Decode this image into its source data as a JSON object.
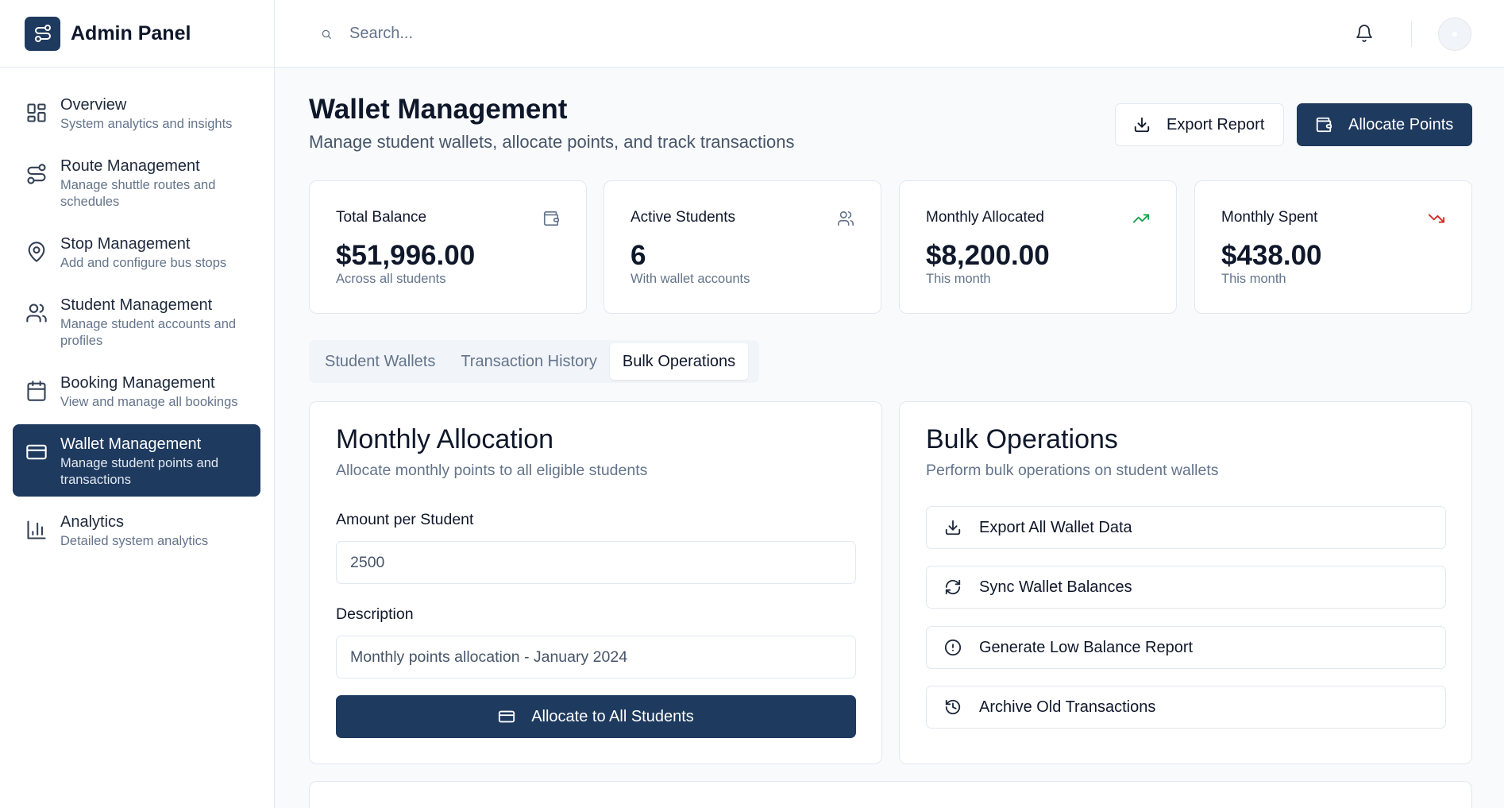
{
  "app": {
    "title": "Admin Panel"
  },
  "search": {
    "placeholder": "Search..."
  },
  "sidebar": {
    "items": [
      {
        "label": "Overview",
        "desc": "System analytics and insights",
        "icon": "grid-icon"
      },
      {
        "label": "Route Management",
        "desc": "Manage shuttle routes and schedules",
        "icon": "route-icon"
      },
      {
        "label": "Stop Management",
        "desc": "Add and configure bus stops",
        "icon": "map-pin-icon"
      },
      {
        "label": "Student Management",
        "desc": "Manage student accounts and profiles",
        "icon": "users-icon"
      },
      {
        "label": "Booking Management",
        "desc": "View and manage all bookings",
        "icon": "calendar-icon"
      },
      {
        "label": "Wallet Management",
        "desc": "Manage student points and transactions",
        "icon": "credit-card-icon",
        "active": true
      },
      {
        "label": "Analytics",
        "desc": "Detailed system analytics",
        "icon": "bar-chart-icon"
      }
    ]
  },
  "page": {
    "title": "Wallet Management",
    "subtitle": "Manage student wallets, allocate points, and track transactions",
    "export_label": "Export Report",
    "allocate_label": "Allocate Points"
  },
  "stats": [
    {
      "label": "Total Balance",
      "value": "$51,996.00",
      "sub": "Across all students",
      "icon": "wallet-icon",
      "icon_color": "#64748b"
    },
    {
      "label": "Active Students",
      "value": "6",
      "sub": "With wallet accounts",
      "icon": "users-icon",
      "icon_color": "#64748b"
    },
    {
      "label": "Monthly Allocated",
      "value": "$8,200.00",
      "sub": "This month",
      "icon": "trending-up-icon",
      "icon_color": "#16a34a"
    },
    {
      "label": "Monthly Spent",
      "value": "$438.00",
      "sub": "This month",
      "icon": "trending-down-icon",
      "icon_color": "#dc2626"
    }
  ],
  "tabs": [
    {
      "label": "Student Wallets"
    },
    {
      "label": "Transaction History"
    },
    {
      "label": "Bulk Operations",
      "active": true
    }
  ],
  "monthly_allocation": {
    "title": "Monthly Allocation",
    "desc": "Allocate monthly points to all eligible students",
    "amount_label": "Amount per Student",
    "amount_value": "2500",
    "description_label": "Description",
    "description_value": "Monthly points allocation - January 2024",
    "button_label": "Allocate to All Students"
  },
  "bulk_operations": {
    "title": "Bulk Operations",
    "desc": "Perform bulk operations on student wallets",
    "actions": [
      {
        "label": "Export All Wallet Data",
        "icon": "download-icon"
      },
      {
        "label": "Sync Wallet Balances",
        "icon": "refresh-icon"
      },
      {
        "label": "Generate Low Balance Report",
        "icon": "alert-circle-icon"
      },
      {
        "label": "Archive Old Transactions",
        "icon": "history-icon"
      }
    ]
  },
  "colors": {
    "primary": "#1e3a5f",
    "border": "#e2e8f0",
    "muted_text": "#64748b",
    "success": "#16a34a",
    "danger": "#dc2626"
  }
}
